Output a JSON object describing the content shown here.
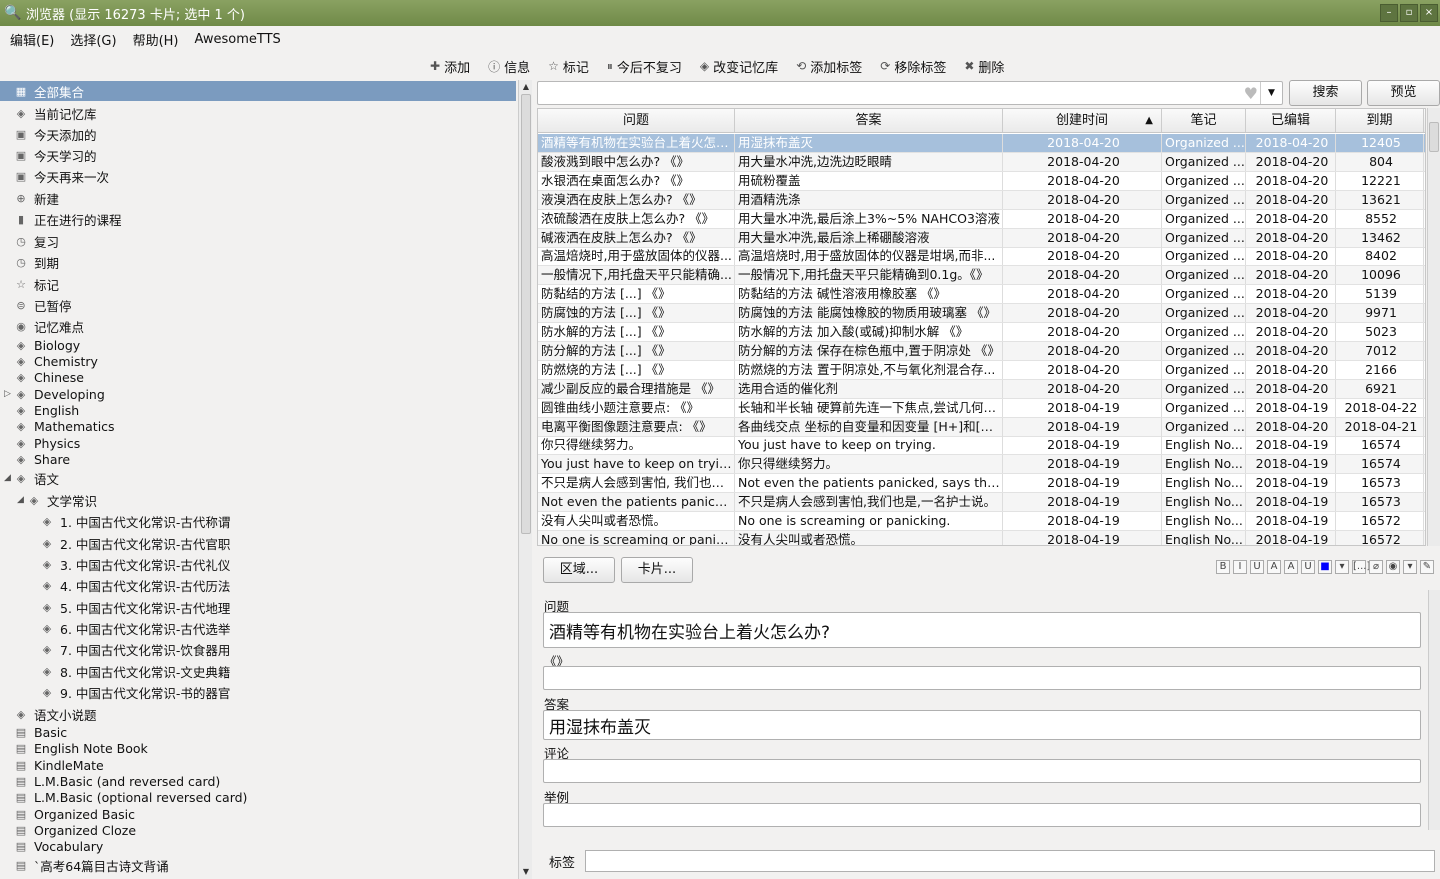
{
  "window": {
    "title": "浏览器 (显示 16273 卡片; 选中 1 个)"
  },
  "menu": [
    "编辑(E)",
    "选择(G)",
    "帮助(H)",
    "AwesomeTTS"
  ],
  "toolbar": [
    {
      "label": "添加",
      "icon": "add-icon"
    },
    {
      "label": "信息",
      "icon": "info-icon"
    },
    {
      "label": "标记",
      "icon": "star-icon"
    },
    {
      "label": "今后不复习",
      "icon": "suspend-icon"
    },
    {
      "label": "改变记忆库",
      "icon": "deck-icon"
    },
    {
      "label": "添加标签",
      "icon": "tag-add-icon"
    },
    {
      "label": "移除标签",
      "icon": "tag-remove-icon"
    },
    {
      "label": "删除",
      "icon": "delete-icon"
    }
  ],
  "sidebar": {
    "items": [
      {
        "label": "全部集合",
        "icon": "collection-icon",
        "indent": 0,
        "selected": true
      },
      {
        "label": "当前记忆库",
        "icon": "deck-icon",
        "indent": 0
      },
      {
        "label": "今天添加的",
        "icon": "calendar-icon",
        "indent": 0
      },
      {
        "label": "今天学习的",
        "icon": "calendar-icon",
        "indent": 0
      },
      {
        "label": "今天再来一次",
        "icon": "calendar-icon",
        "indent": 0
      },
      {
        "label": "新建",
        "icon": "new-icon",
        "indent": 0
      },
      {
        "label": "正在进行的课程",
        "icon": "book-icon",
        "indent": 0
      },
      {
        "label": "复习",
        "icon": "clock-icon",
        "indent": 0
      },
      {
        "label": "到期",
        "icon": "clock-icon",
        "indent": 0
      },
      {
        "label": "标记",
        "icon": "star-icon",
        "indent": 0
      },
      {
        "label": "已暂停",
        "icon": "pause-icon",
        "indent": 0
      },
      {
        "label": "记忆难点",
        "icon": "leech-icon",
        "indent": 0
      },
      {
        "label": "Biology",
        "icon": "deck-icon",
        "indent": 0
      },
      {
        "label": "Chemistry",
        "icon": "deck-icon",
        "indent": 0
      },
      {
        "label": "Chinese",
        "icon": "deck-icon",
        "indent": 0
      },
      {
        "label": "Developing",
        "icon": "deck-icon",
        "indent": 0,
        "expander": "▷"
      },
      {
        "label": "English",
        "icon": "deck-icon",
        "indent": 0
      },
      {
        "label": "Mathematics",
        "icon": "deck-icon",
        "indent": 0
      },
      {
        "label": "Physics",
        "icon": "deck-icon",
        "indent": 0
      },
      {
        "label": "Share",
        "icon": "deck-icon",
        "indent": 0
      },
      {
        "label": "语文",
        "icon": "deck-icon",
        "indent": 0,
        "expander": "◢"
      },
      {
        "label": "文学常识",
        "icon": "deck-icon",
        "indent": 1,
        "expander": "◢"
      },
      {
        "label": "1. 中国古代文化常识-古代称谓",
        "icon": "deck-icon",
        "indent": 2
      },
      {
        "label": "2. 中国古代文化常识-古代官职",
        "icon": "deck-icon",
        "indent": 2
      },
      {
        "label": "3. 中国古代文化常识-古代礼仪",
        "icon": "deck-icon",
        "indent": 2
      },
      {
        "label": "4. 中国古代文化常识-古代历法",
        "icon": "deck-icon",
        "indent": 2
      },
      {
        "label": "5. 中国古代文化常识-古代地理",
        "icon": "deck-icon",
        "indent": 2
      },
      {
        "label": "6. 中国古代文化常识-古代选举",
        "icon": "deck-icon",
        "indent": 2
      },
      {
        "label": "7. 中国古代文化常识-饮食器用",
        "icon": "deck-icon",
        "indent": 2
      },
      {
        "label": "8. 中国古代文化常识-文史典籍",
        "icon": "deck-icon",
        "indent": 2
      },
      {
        "label": "9. 中国古代文化常识-书的器官",
        "icon": "deck-icon",
        "indent": 2
      },
      {
        "label": "语文小说题",
        "icon": "deck-icon",
        "indent": 0
      },
      {
        "label": "Basic",
        "icon": "notetype-icon",
        "indent": 0
      },
      {
        "label": "English Note Book",
        "icon": "notetype-icon",
        "indent": 0
      },
      {
        "label": "KindleMate",
        "icon": "notetype-icon",
        "indent": 0
      },
      {
        "label": "L.M.Basic (and reversed card)",
        "icon": "notetype-icon",
        "indent": 0
      },
      {
        "label": "L.M.Basic (optional reversed card)",
        "icon": "notetype-icon",
        "indent": 0
      },
      {
        "label": "Organized Basic",
        "icon": "notetype-icon",
        "indent": 0
      },
      {
        "label": "Organized Cloze",
        "icon": "notetype-icon",
        "indent": 0
      },
      {
        "label": "Vocabulary",
        "icon": "notetype-icon",
        "indent": 0
      },
      {
        "label": "`高考64篇目古诗文背诵",
        "icon": "notetype-icon",
        "indent": 0
      }
    ]
  },
  "search": {
    "value": "",
    "search_button": "搜索",
    "preview_button": "预览"
  },
  "table": {
    "columns": [
      "问题",
      "答案",
      "创建时间",
      "笔记",
      "已编辑",
      "到期"
    ],
    "rows": [
      [
        "酒精等有机物在实验台上着火怎么...",
        "用湿抹布盖灭",
        "2018-04-20",
        "Organized ...",
        "2018-04-20",
        "12405"
      ],
      [
        "酸液溅到眼中怎么办? 《》",
        "用大量水冲洗,边洗边眨眼睛",
        "2018-04-20",
        "Organized ...",
        "2018-04-20",
        "804"
      ],
      [
        "水银洒在桌面怎么办? 《》",
        "用硫粉覆盖",
        "2018-04-20",
        "Organized ...",
        "2018-04-20",
        "12221"
      ],
      [
        "液溴洒在皮肤上怎么办? 《》",
        "用酒精洗涤",
        "2018-04-20",
        "Organized ...",
        "2018-04-20",
        "13621"
      ],
      [
        "浓硫酸洒在皮肤上怎么办? 《》",
        "用大量水冲洗,最后涂上3%~5% NAHCO3溶液",
        "2018-04-20",
        "Organized ...",
        "2018-04-20",
        "8552"
      ],
      [
        "碱液洒在皮肤上怎么办? 《》",
        "用大量水冲洗,最后涂上稀硼酸溶液",
        "2018-04-20",
        "Organized ...",
        "2018-04-20",
        "13462"
      ],
      [
        "高温焙烧时,用于盛放固体的仪器...",
        "高温焙烧时,用于盛放固体的仪器是坩埚,而非...",
        "2018-04-20",
        "Organized ...",
        "2018-04-20",
        "8402"
      ],
      [
        "一般情况下,用托盘天平只能精确...",
        "一般情况下,用托盘天平只能精确到0.1g。《》",
        "2018-04-20",
        "Organized ...",
        "2018-04-20",
        "10096"
      ],
      [
        "防黏结的方法 [...] 《》",
        "防黏结的方法 碱性溶液用橡胶塞 《》",
        "2018-04-20",
        "Organized ...",
        "2018-04-20",
        "5139"
      ],
      [
        "防腐蚀的方法 [...] 《》",
        "防腐蚀的方法 能腐蚀橡胶的物质用玻璃塞 《》",
        "2018-04-20",
        "Organized ...",
        "2018-04-20",
        "9971"
      ],
      [
        "防水解的方法 [...] 《》",
        "防水解的方法 加入酸(或碱)抑制水解 《》",
        "2018-04-20",
        "Organized ...",
        "2018-04-20",
        "5023"
      ],
      [
        "防分解的方法 [...] 《》",
        "防分解的方法 保存在棕色瓶中,置于阴凉处 《》",
        "2018-04-20",
        "Organized ...",
        "2018-04-20",
        "7012"
      ],
      [
        "防燃烧的方法 [...] 《》",
        "防燃烧的方法 置于阴凉处,不与氧化剂混合存...",
        "2018-04-20",
        "Organized ...",
        "2018-04-20",
        "2166"
      ],
      [
        "减少副反应的最合理措施是 《》",
        "选用合适的催化剂",
        "2018-04-20",
        "Organized ...",
        "2018-04-20",
        "6921"
      ],
      [
        "圆锥曲线小题注意要点: 《》",
        "长轴和半长轴 硬算前先连一下焦点,尝试几何法...",
        "2018-04-19",
        "Organized ...",
        "2018-04-19",
        "2018-04-22"
      ],
      [
        "电离平衡图像题注意要点: 《》",
        "各曲线交点 坐标的自变量和因变量 [H+]和[OH-...",
        "2018-04-19",
        "Organized ...",
        "2018-04-20",
        "2018-04-21"
      ],
      [
        "你只得继续努力。",
        "You just have to keep on trying.",
        "2018-04-19",
        "English No...",
        "2018-04-19",
        "16574"
      ],
      [
        "You just have to keep on trying.",
        "你只得继续努力。",
        "2018-04-19",
        "English No...",
        "2018-04-19",
        "16574"
      ],
      [
        "不只是病人会感到害怕, 我们也是, ...",
        "Not even the patients panicked, says the nur...",
        "2018-04-19",
        "English No...",
        "2018-04-19",
        "16573"
      ],
      [
        "Not even the patients panicked, ...",
        "不只是病人会感到害怕,我们也是,一名护士说。",
        "2018-04-19",
        "English No...",
        "2018-04-19",
        "16573"
      ],
      [
        "没有人尖叫或者恐慌。",
        "No one is screaming or panicking.",
        "2018-04-19",
        "English No...",
        "2018-04-19",
        "16572"
      ],
      [
        "No one is screaming or panicking.",
        "没有人尖叫或者恐慌。",
        "2018-04-19",
        "English No...",
        "2018-04-19",
        "16572"
      ]
    ],
    "selected_row": 0,
    "sort_column": "创建时间"
  },
  "editor": {
    "fields_button": "区域...",
    "cards_button": "卡片...",
    "format_buttons": [
      "B",
      "I",
      "U",
      "A",
      "A",
      "U",
      "■",
      "▾",
      "[...]",
      "⌀",
      "◉",
      "▾",
      "✎"
    ],
    "fields": [
      {
        "label": "问题",
        "value": "酒精等有机物在实验台上着火怎么办?"
      },
      {
        "label": "《》",
        "value": ""
      },
      {
        "label": "答案",
        "value": "用湿抹布盖灭"
      },
      {
        "label": "评论",
        "value": ""
      },
      {
        "label": "举例",
        "value": ""
      }
    ],
    "tags_label": "标签",
    "tags_value": ""
  }
}
